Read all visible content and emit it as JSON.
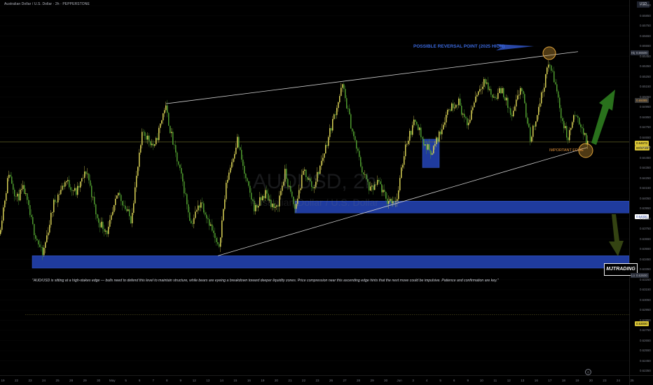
{
  "header": {
    "title": "Australian Dollar / U.S. Dollar · 2h · PEPPERSTONE"
  },
  "watermark": {
    "symbol": "AUDUSD, 2h",
    "name": "Australian Dollar / U.S. Dollar"
  },
  "annotations": {
    "reversal_label": "POSSIBLE REVERSAL POINT (2025 HIGH)",
    "edge_label": "IMPORTANT EDGE",
    "caption": "\"AUD/USD is sitting at a high-stakes edge — bulls need to defend this level to maintain structure, while bears are eyeing a breakdown toward deeper liquidity zones. Price compression near this ascending edge hints that the next move could be impulsive. Patience and confirmation are key.\"",
    "brand": "MJTRADING"
  },
  "price_axis": {
    "currency": "USD",
    "high_label": "High",
    "low_label": "Low",
    "ticks": [
      "0.65950",
      "0.65850",
      "0.65750",
      "0.65650",
      "0.65550",
      "0.65450",
      "0.65350",
      "0.65250",
      "0.65150",
      "0.65050",
      "0.64950",
      "0.64850",
      "0.64750",
      "0.64650",
      "0.64550",
      "0.64450",
      "0.64350",
      "0.64250",
      "0.64150",
      "0.64050",
      "0.63950",
      "0.63850",
      "0.63750",
      "0.63650",
      "0.63550",
      "0.63450",
      "0.63350",
      "0.63250",
      "0.63150",
      "0.63050",
      "0.62950",
      "0.62850",
      "0.62750",
      "0.62650",
      "0.62550",
      "0.62450",
      "0.62350"
    ],
    "tags": {
      "high": "0.65500",
      "upper": "0.65085",
      "last": "0.64673",
      "last_time": "00:57:23",
      "zone": "0.64000",
      "low": "0.63600",
      "lower": "0.63000"
    }
  },
  "time_axis": {
    "labels": [
      "19",
      "22",
      "23",
      "24",
      "25",
      "28",
      "29",
      "30",
      "May",
      "5",
      "6",
      "7",
      "8",
      "9",
      "12",
      "13",
      "14",
      "15",
      "16",
      "19",
      "20",
      "21",
      "22",
      "23",
      "26",
      "27",
      "28",
      "29",
      "30",
      "Jun",
      "3",
      "4",
      "5",
      "6",
      "9",
      "10",
      "11",
      "12",
      "13",
      "16",
      "17",
      "18",
      "19",
      "20",
      "23",
      "24",
      "25"
    ]
  },
  "colors": {
    "background": "#000000",
    "candle_up": "#d8d055",
    "candle_down": "#4e9a2e",
    "zone": "#1f3b9e",
    "trendline": "#cfcfcf",
    "arrow_up": "#2e7d1f",
    "arrow_down": "#3a4a14",
    "circle": "#e0a43a",
    "reversal_arrow": "#2e4fb8"
  },
  "chart_data": {
    "type": "candlestick",
    "symbol": "AUDUSD",
    "timeframe": "2h",
    "ylim": [
      0.6235,
      0.6601
    ],
    "price_path": [
      {
        "x": 0,
        "y": 0.6378
      },
      {
        "x": 14,
        "y": 0.6438
      },
      {
        "x": 25,
        "y": 0.6412
      },
      {
        "x": 35,
        "y": 0.6422
      },
      {
        "x": 48,
        "y": 0.6385
      },
      {
        "x": 62,
        "y": 0.6357
      },
      {
        "x": 78,
        "y": 0.6408
      },
      {
        "x": 95,
        "y": 0.643
      },
      {
        "x": 110,
        "y": 0.6418
      },
      {
        "x": 125,
        "y": 0.644
      },
      {
        "x": 140,
        "y": 0.6392
      },
      {
        "x": 155,
        "y": 0.638
      },
      {
        "x": 170,
        "y": 0.6418
      },
      {
        "x": 188,
        "y": 0.6392
      },
      {
        "x": 205,
        "y": 0.6478
      },
      {
        "x": 222,
        "y": 0.6462
      },
      {
        "x": 237,
        "y": 0.6503
      },
      {
        "x": 250,
        "y": 0.646
      },
      {
        "x": 262,
        "y": 0.6428
      },
      {
        "x": 274,
        "y": 0.6388
      },
      {
        "x": 288,
        "y": 0.641
      },
      {
        "x": 300,
        "y": 0.639
      },
      {
        "x": 313,
        "y": 0.6362
      },
      {
        "x": 325,
        "y": 0.643
      },
      {
        "x": 340,
        "y": 0.647
      },
      {
        "x": 352,
        "y": 0.643
      },
      {
        "x": 365,
        "y": 0.6402
      },
      {
        "x": 380,
        "y": 0.6418
      },
      {
        "x": 395,
        "y": 0.64
      },
      {
        "x": 408,
        "y": 0.6437
      },
      {
        "x": 422,
        "y": 0.6402
      },
      {
        "x": 435,
        "y": 0.644
      },
      {
        "x": 448,
        "y": 0.6422
      },
      {
        "x": 460,
        "y": 0.6448
      },
      {
        "x": 475,
        "y": 0.6485
      },
      {
        "x": 490,
        "y": 0.6522
      },
      {
        "x": 505,
        "y": 0.6475
      },
      {
        "x": 518,
        "y": 0.644
      },
      {
        "x": 530,
        "y": 0.642
      },
      {
        "x": 542,
        "y": 0.6428
      },
      {
        "x": 553,
        "y": 0.641
      },
      {
        "x": 568,
        "y": 0.6412
      },
      {
        "x": 580,
        "y": 0.6465
      },
      {
        "x": 595,
        "y": 0.649
      },
      {
        "x": 606,
        "y": 0.6465
      },
      {
        "x": 618,
        "y": 0.6458
      },
      {
        "x": 630,
        "y": 0.6478
      },
      {
        "x": 640,
        "y": 0.6498
      },
      {
        "x": 655,
        "y": 0.6508
      },
      {
        "x": 668,
        "y": 0.6482
      },
      {
        "x": 680,
        "y": 0.6512
      },
      {
        "x": 692,
        "y": 0.6528
      },
      {
        "x": 705,
        "y": 0.651
      },
      {
        "x": 718,
        "y": 0.6518
      },
      {
        "x": 732,
        "y": 0.649
      },
      {
        "x": 745,
        "y": 0.6522
      },
      {
        "x": 758,
        "y": 0.647
      },
      {
        "x": 770,
        "y": 0.65
      },
      {
        "x": 785,
        "y": 0.6545
      },
      {
        "x": 795,
        "y": 0.652
      },
      {
        "x": 803,
        "y": 0.649
      },
      {
        "x": 812,
        "y": 0.647
      },
      {
        "x": 820,
        "y": 0.6492
      },
      {
        "x": 830,
        "y": 0.6485
      },
      {
        "x": 838,
        "y": 0.6467
      }
    ],
    "zones": [
      {
        "x0": 421,
        "x1": 898,
        "y_top": 0.641,
        "y_bottom": 0.63985
      },
      {
        "x0": 46,
        "x1": 898,
        "y_top": 0.6357,
        "y_bottom": 0.6345
      },
      {
        "x0": 603,
        "x1": 627,
        "y_top": 0.647,
        "y_bottom": 0.64425
      }
    ],
    "trendlines": [
      {
        "x0": 237,
        "y0": 0.65045,
        "x1": 825,
        "y1": 0.6555
      },
      {
        "x0": 311,
        "y0": 0.6357,
        "x1": 838,
        "y1": 0.6462
      }
    ],
    "levels": [
      {
        "y": 0.64673
      },
      {
        "y": 0.63
      }
    ]
  }
}
